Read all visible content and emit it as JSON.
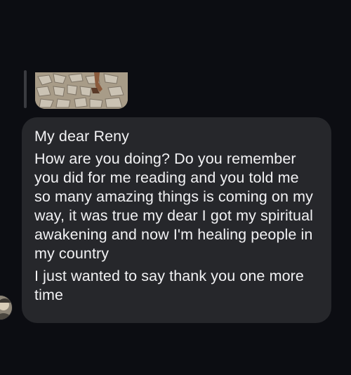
{
  "conversation": {
    "quoted_attachment": {
      "icon": "photo-thumbnail"
    },
    "message": {
      "lines": [
        "My dear Reny",
        "How are you doing? Do you remember you did for me reading and you told me so many amazing things is coming on my way, it was true my dear I got my spiritual awakening and now I'm healing people in my country",
        "I just wanted to say thank you one more time"
      ]
    },
    "sender": {
      "avatar_icon": "profile-avatar"
    }
  },
  "colors": {
    "background": "#0c0d12",
    "bubble": "#26272b",
    "text": "#f2f2f4",
    "reply_bar": "#3a3b40"
  }
}
